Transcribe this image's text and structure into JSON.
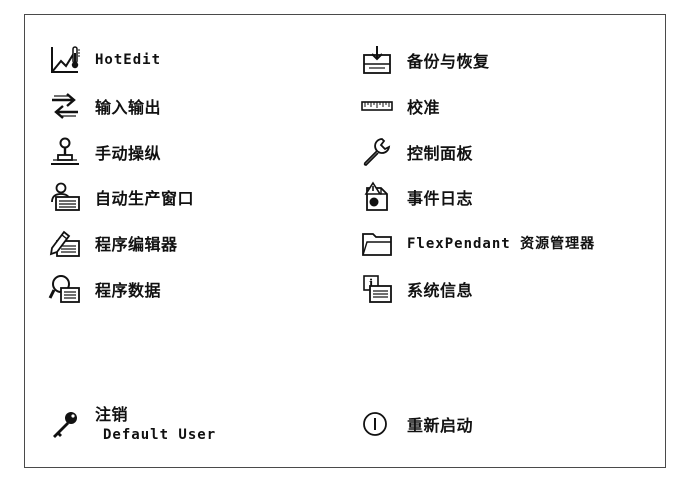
{
  "left_items": [
    {
      "label": "HotEdit",
      "icon": "hotedit-icon",
      "mono": true
    },
    {
      "label": "输入输出",
      "icon": "io-arrows-icon"
    },
    {
      "label": "手动操纵",
      "icon": "joystick-icon"
    },
    {
      "label": "自动生产窗口",
      "icon": "auto-production-icon"
    },
    {
      "label": "程序编辑器",
      "icon": "program-editor-icon"
    },
    {
      "label": "程序数据",
      "icon": "program-data-icon"
    }
  ],
  "right_items": [
    {
      "label": "备份与恢复",
      "icon": "backup-restore-icon"
    },
    {
      "label": "校准",
      "icon": "calibration-ruler-icon"
    },
    {
      "label": "控制面板",
      "icon": "wrench-icon"
    },
    {
      "label": "事件日志",
      "icon": "event-log-icon"
    },
    {
      "label": "FlexPendant 资源管理器",
      "icon": "folder-icon",
      "mono_prefix": "FlexPendant",
      "suffix": " 资源管理器"
    },
    {
      "label": "系统信息",
      "icon": "system-info-icon"
    }
  ],
  "logout": {
    "label": "注销",
    "user": "Default User",
    "icon": "key-icon"
  },
  "restart": {
    "label": "重新启动",
    "icon": "power-icon"
  }
}
